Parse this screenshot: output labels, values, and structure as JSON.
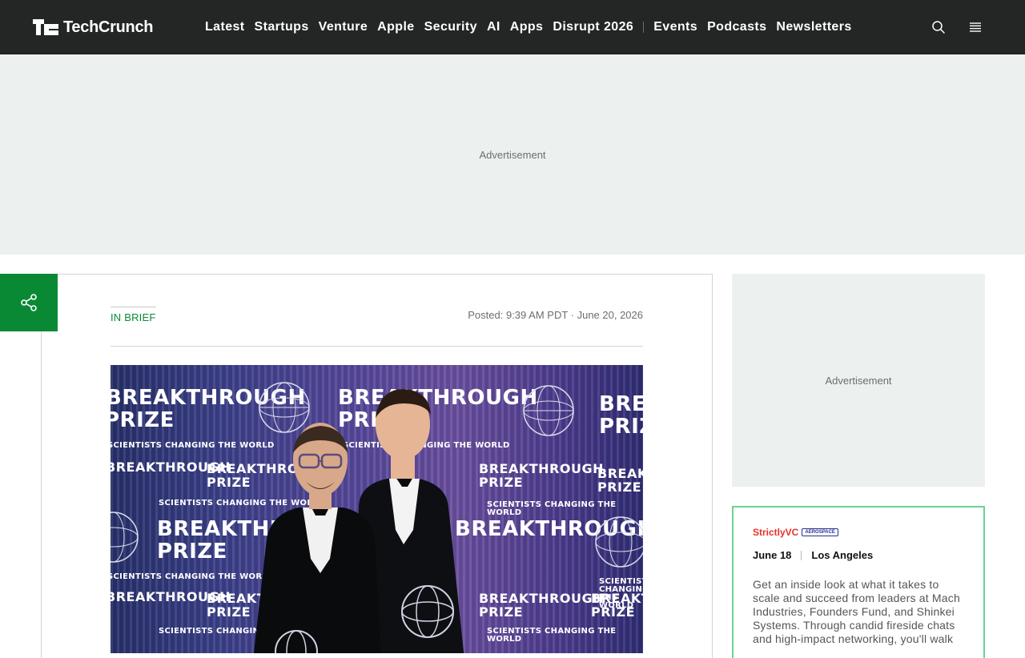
{
  "header": {
    "logo_text": "TechCrunch",
    "nav_primary": [
      "Latest",
      "Startups",
      "Venture",
      "Apple",
      "Security",
      "AI",
      "Apps",
      "Disrupt 2026"
    ],
    "nav_secondary": [
      "Events",
      "Podcasts",
      "Newsletters"
    ],
    "icons": [
      "search-icon",
      "menu-icon"
    ]
  },
  "ads": {
    "top_label": "Advertisement",
    "side_label": "Advertisement"
  },
  "article": {
    "tag": "IN BRIEF",
    "posted": "Posted: 9:39 AM PDT · June 20, 2026",
    "image_text": {
      "brand_line1": "BREAKTHROUGH",
      "brand_line2": "PRIZE",
      "tagline": "SCIENTISTS CHANGING THE WORLD"
    }
  },
  "event": {
    "brand": "StrictlyVC",
    "partner": "AEROSPACE",
    "date": "June 18",
    "location": "Los Angeles",
    "description": "Get an inside look at what it takes to scale and succeed from leaders at Mach Industries, Founders Fund, and Shinkei Systems. Through candid fireside chats and high-impact networking, you'll walk"
  },
  "colors": {
    "header_bg": "#232624",
    "accent_green": "#0a8935",
    "ad_bg": "#ecf0ef",
    "event_border": "#68d391",
    "strictly_red": "#e4322b"
  }
}
